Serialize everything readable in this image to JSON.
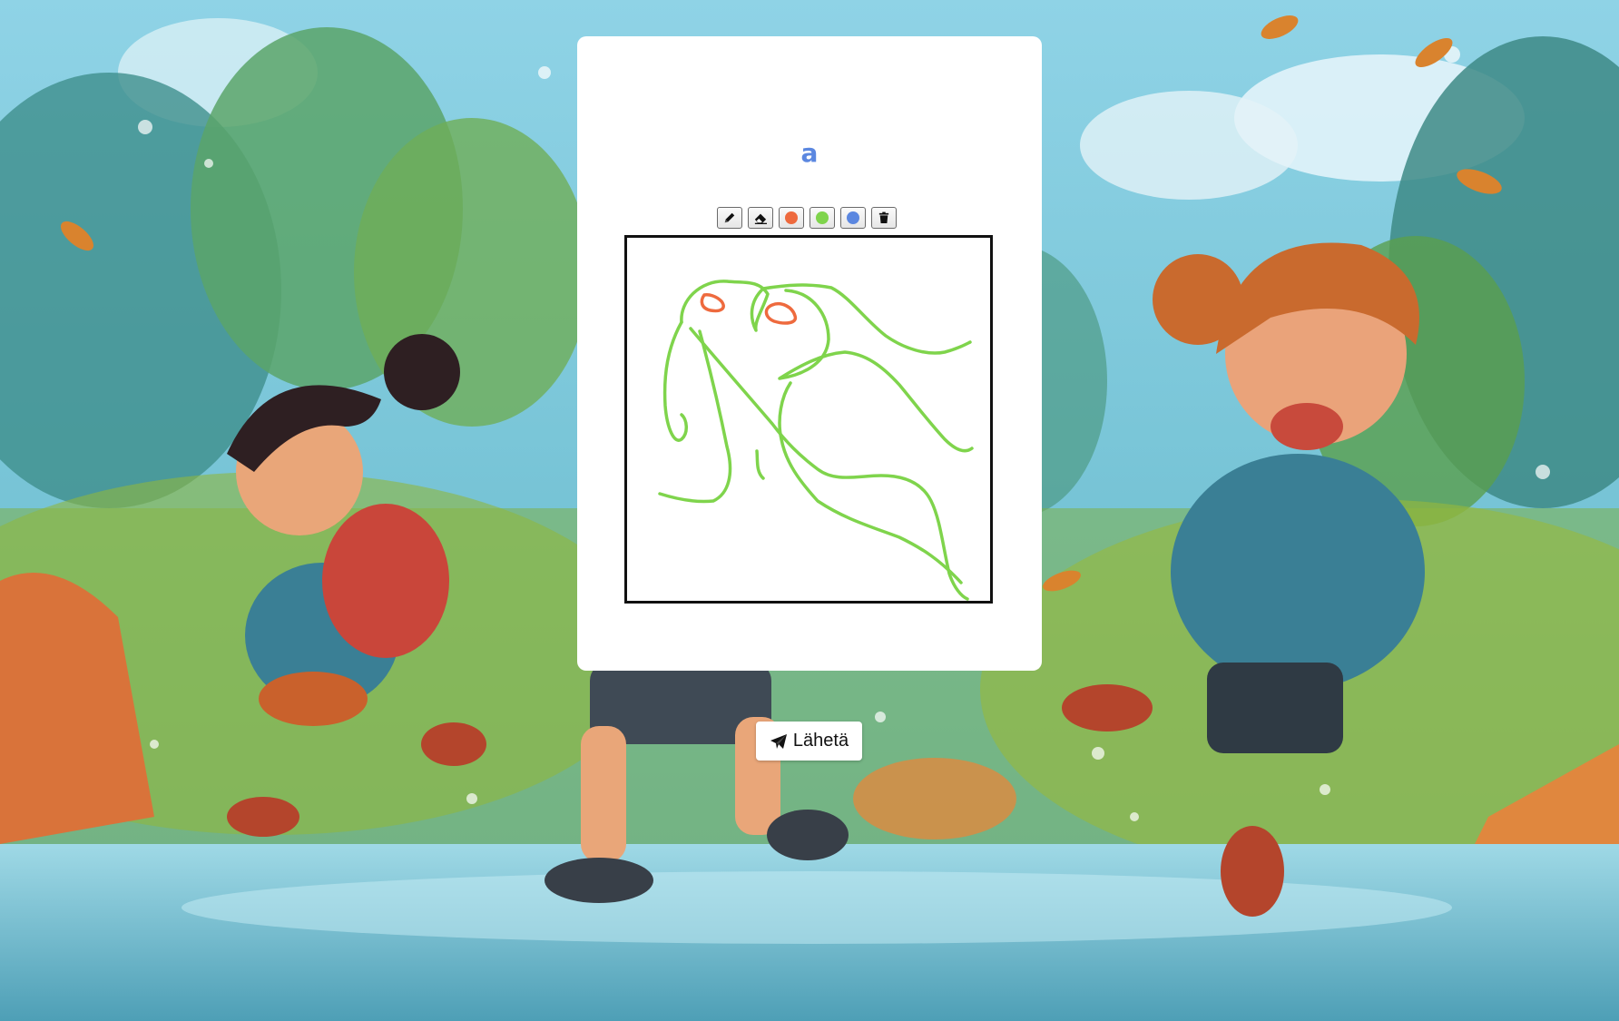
{
  "prompt": {
    "text": "a"
  },
  "toolbar": {
    "tools": [
      {
        "icon": "pencil-icon"
      },
      {
        "icon": "eraser-icon"
      },
      {
        "icon": "color-swatch",
        "color": "#ee6a3e"
      },
      {
        "icon": "color-swatch",
        "color": "#7fd44c"
      },
      {
        "icon": "color-swatch",
        "color": "#5b87e0"
      },
      {
        "icon": "trash-icon"
      }
    ]
  },
  "send_button": {
    "label": "Lähetä",
    "icon": "paper-plane-icon"
  },
  "colors": {
    "prompt": "#5b87e0",
    "stroke_red": "#ee6a3e",
    "stroke_green": "#7fd44c",
    "stroke_blue": "#5b87e0",
    "canvas_border": "#111111",
    "card": "#ffffff"
  }
}
